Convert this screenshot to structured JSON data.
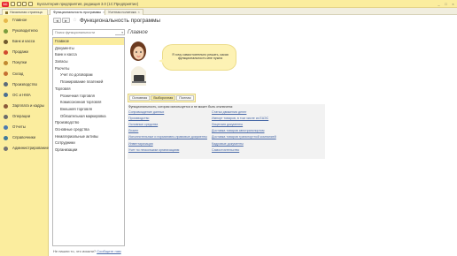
{
  "window": {
    "logo_text": "1С",
    "title": "Бухгалтерия предприятия, редакция 3.0  (1С:Предприятие)",
    "controls": [
      "_",
      "□",
      "×"
    ]
  },
  "tabs": {
    "home_label": "Начальная страница",
    "items": [
      {
        "label": "Функциональность программы"
      },
      {
        "label": "Учетная политика"
      }
    ],
    "close_glyph": "×"
  },
  "sidebar": {
    "items": [
      {
        "label": "Главное",
        "color": "#e6b84a"
      },
      {
        "label": "Руководителю",
        "color": "#7a9c3e"
      },
      {
        "label": "Банк и касса",
        "color": "#6f5a2e"
      },
      {
        "label": "Продажи",
        "color": "#d04a2e"
      },
      {
        "label": "Покупки",
        "color": "#c08a30"
      },
      {
        "label": "Склад",
        "color": "#c47032"
      },
      {
        "label": "Производство",
        "color": "#5b6b7a"
      },
      {
        "label": "ОС и НМА",
        "color": "#4b6f92"
      },
      {
        "label": "Зарплата и кадры",
        "color": "#8b5a3a"
      },
      {
        "label": "Операции",
        "color": "#6b6b6b"
      },
      {
        "label": "Отчеты",
        "color": "#4c7ab0"
      },
      {
        "label": "Справочники",
        "color": "#3f7a9a"
      },
      {
        "label": "Администрирование",
        "color": "#737373"
      }
    ]
  },
  "toolbar": {
    "back": "◄",
    "forward": "►",
    "star": "☆",
    "title": "Функциональность программы"
  },
  "search": {
    "placeholder": "Поиск функциональности",
    "dropdown_glyph": "▾"
  },
  "tree": [
    {
      "label": "Главное",
      "level": 0,
      "selected": true
    },
    {
      "label": "Документы",
      "level": 0
    },
    {
      "label": "Банк и касса",
      "level": 0
    },
    {
      "label": "Запасы",
      "level": 0
    },
    {
      "label": "Расчеты",
      "level": 0
    },
    {
      "label": "Учет по договорам",
      "level": 1
    },
    {
      "label": "Планирование платежей",
      "level": 1
    },
    {
      "label": "Торговля",
      "level": 0
    },
    {
      "label": "Розничная торговля",
      "level": 1
    },
    {
      "label": "Комиссионная торговля",
      "level": 1
    },
    {
      "label": "Внешняя торговля",
      "level": 1
    },
    {
      "label": "Обязательная маркировка",
      "level": 1
    },
    {
      "label": "Производство",
      "level": 0
    },
    {
      "label": "Основные средства",
      "level": 0
    },
    {
      "label": "Нематериальные активы",
      "level": 0
    },
    {
      "label": "Сотрудники",
      "level": 0
    },
    {
      "label": "Организации",
      "level": 0
    }
  ],
  "footer": {
    "text": "Не нашли то, что искали?",
    "link": "Сообщите нам"
  },
  "right": {
    "title": "Главное",
    "assistant_text": "Я хочу самостоятельно решать, какая функциональность мне нужна",
    "modes": [
      {
        "label": "Основная",
        "active": false
      },
      {
        "label": "Выборочная",
        "active": true
      },
      {
        "label": "Полная",
        "active": false
      }
    ],
    "options_caption": "Функциональность, которая используется и не может быть отключена:",
    "options_left": [
      "Сопровождение данных",
      "Производство",
      "Основные средства",
      "Лизинг",
      "Исполнительные и нормативно-правовые документы",
      "Инвентаризация",
      "Учет по нескольким организациям"
    ],
    "options_right": [
      "Статьи движения денег",
      "Импорт товаров, в том числе из ЕАЭС",
      "Лицензия документы",
      "Доставка товаров автотранспортом",
      "Доставка товаров транспортной компанией",
      "Кадровые документы",
      "Самостоятельство"
    ]
  }
}
